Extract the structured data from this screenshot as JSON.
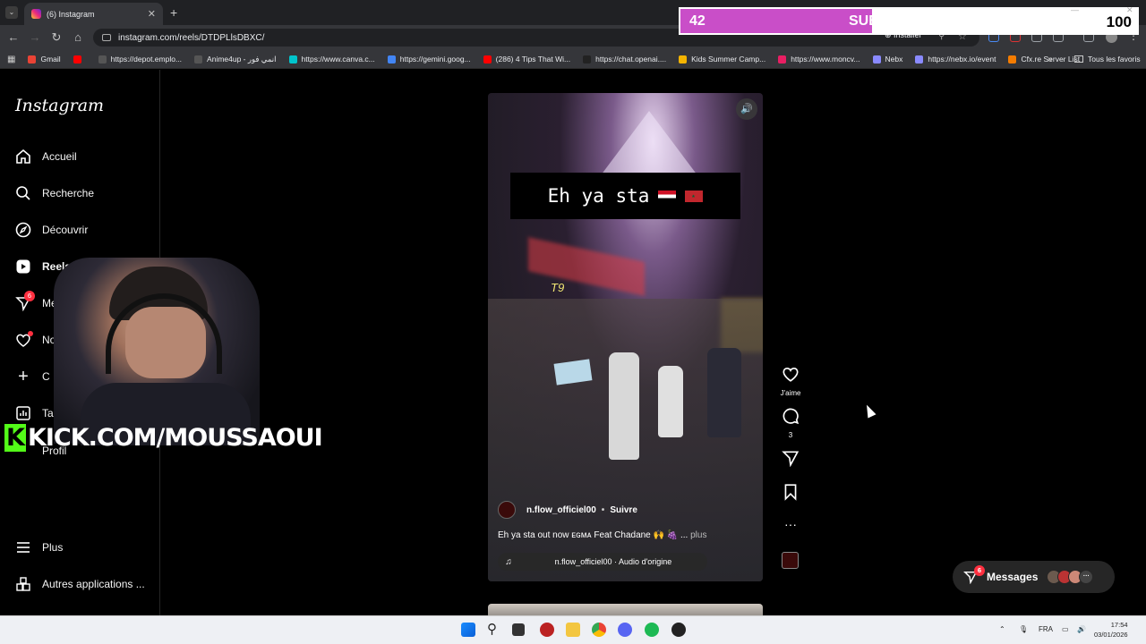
{
  "browser": {
    "tab_title": "(6) Instagram",
    "url": "instagram.com/reels/DTDPLlsDBXC/",
    "install_label": "Installer",
    "bookmarks": [
      {
        "label": "Gmail",
        "color": "#ea4335"
      },
      {
        "label": "",
        "color": "#ff0000"
      },
      {
        "label": "https://depot.emplo...",
        "color": "#555555"
      },
      {
        "label": "Anime4up - انمي فور",
        "color": "#555555"
      },
      {
        "label": "https://www.canva.c...",
        "color": "#00c4cc"
      },
      {
        "label": "https://gemini.goog...",
        "color": "#4285f4"
      },
      {
        "label": "(286) 4 Tips That Wi...",
        "color": "#ff0000"
      },
      {
        "label": "https://chat.openai....",
        "color": "#222222"
      },
      {
        "label": "Kids Summer Camp...",
        "color": "#f4b400"
      },
      {
        "label": "https://www.moncv...",
        "color": "#e91e63"
      },
      {
        "label": "Nebx",
        "color": "#8a8aff"
      },
      {
        "label": "https://nebx.io/event",
        "color": "#8a8aff"
      },
      {
        "label": "Cfx.re Server List",
        "color": "#f57c00"
      }
    ],
    "all_bookmarks_label": "Tous les favoris"
  },
  "subs_overlay": {
    "current": "42",
    "label": "SUBSCRIBERS",
    "goal": "100",
    "progress_fraction": 0.42,
    "fill_color": "#c94ec8"
  },
  "sidebar": {
    "logo": "Instagram",
    "items": [
      {
        "label": "Accueil",
        "icon": "home-icon"
      },
      {
        "label": "Recherche",
        "icon": "search-icon"
      },
      {
        "label": "Découvrir",
        "icon": "compass-icon"
      },
      {
        "label": "Reels",
        "icon": "reels-icon"
      },
      {
        "label": "Message",
        "icon": "messenger-icon",
        "badge": "6"
      },
      {
        "label": "Notif",
        "icon": "heart-icon"
      },
      {
        "label": "C",
        "icon": "plus-icon"
      },
      {
        "label": "Ta",
        "icon": "dashboard-icon"
      },
      {
        "label": "Profil",
        "icon": "profile-icon"
      },
      {
        "label": "Plus",
        "icon": "menu-icon"
      },
      {
        "label": "Autres applications ...",
        "icon": "apps-icon"
      }
    ]
  },
  "reel": {
    "caption_overlay": "Eh ya sta",
    "author": "n.flow_officiel00",
    "separator": "•",
    "follow_label": "Suivre",
    "caption": "Eh ya sta out now ᴇɢᴍᴀ Feat Chadane 🙌 🍇 ...",
    "more_label": "plus",
    "audio": "n.flow_officiel00 · Audio d'origine",
    "like_label": "J'aime",
    "comment_count": "3"
  },
  "messages": {
    "label": "Messages",
    "badge": "6"
  },
  "stream": {
    "kick_text": "KICK.COM/MOUSSAOUI"
  },
  "taskbar": {
    "lang": "FRA",
    "time": "17:54",
    "date": "03/01/2026"
  }
}
